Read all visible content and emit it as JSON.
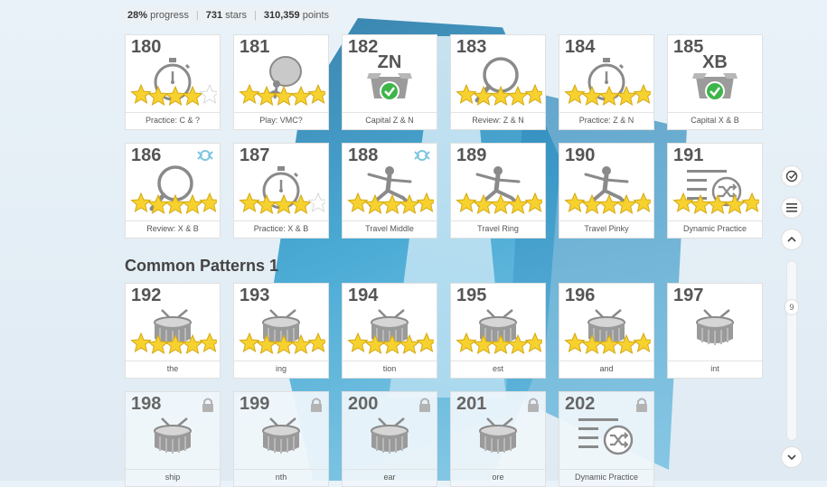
{
  "stats": {
    "progress_value": "28%",
    "progress_label": "progress",
    "stars_value": "731",
    "stars_label": "stars",
    "points_value": "310,359",
    "points_label": "points"
  },
  "section_title": "Common Patterns 1",
  "scroll_indicator": "9",
  "colors": {
    "star_fill": "#f7d22f",
    "star_stroke": "#d4a915",
    "star_empty": "#ffffff",
    "check_green": "#3eb54a",
    "icon_gray": "#8a8a8a"
  },
  "tiles": [
    {
      "num": "180",
      "label": "Practice: C & ?",
      "icon": "stopwatch-icon",
      "stars": 4
    },
    {
      "num": "181",
      "label": "Play: VMC?",
      "icon": "ball-player-icon",
      "stars": 5
    },
    {
      "num": "182",
      "label": "Capital Z & N",
      "icon": "box-check-icon",
      "letters": "ZN",
      "stars": 0
    },
    {
      "num": "183",
      "label": "Review: Z & N",
      "icon": "magnifier-icon",
      "stars": 5
    },
    {
      "num": "184",
      "label": "Practice: Z & N",
      "icon": "stopwatch-icon",
      "stars": 5
    },
    {
      "num": "185",
      "label": "Capital X & B",
      "icon": "box-check-icon",
      "letters": "XB",
      "stars": 0
    },
    {
      "num": "186",
      "label": "Review: X & B",
      "icon": "magnifier-icon",
      "stars": 5,
      "badge": "medal-icon"
    },
    {
      "num": "187",
      "label": "Practice: X & B",
      "icon": "stopwatch-icon",
      "stars": 4
    },
    {
      "num": "188",
      "label": "Travel Middle",
      "icon": "yoga-pose-icon",
      "stars": 5,
      "badge": "medal-icon"
    },
    {
      "num": "189",
      "label": "Travel Ring",
      "icon": "yoga-pose-icon",
      "stars": 5
    },
    {
      "num": "190",
      "label": "Travel Pinky",
      "icon": "yoga-pose-icon",
      "stars": 5
    },
    {
      "num": "191",
      "label": "Dynamic Practice",
      "icon": "shuffle-list-icon",
      "stars": 5
    },
    {
      "num": "192",
      "label": "the",
      "icon": "drum-icon",
      "stars": 5
    },
    {
      "num": "193",
      "label": "ing",
      "icon": "drum-icon",
      "stars": 5
    },
    {
      "num": "194",
      "label": "tion",
      "icon": "drum-icon",
      "stars": 5
    },
    {
      "num": "195",
      "label": "est",
      "icon": "drum-icon",
      "stars": 5
    },
    {
      "num": "196",
      "label": "and",
      "icon": "drum-icon",
      "stars": 5
    },
    {
      "num": "197",
      "label": "int",
      "icon": "drum-icon",
      "stars": 0
    },
    {
      "num": "198",
      "label": "ship",
      "icon": "drum-icon",
      "stars": 0,
      "locked": true
    },
    {
      "num": "199",
      "label": "nth",
      "icon": "drum-icon",
      "stars": 0,
      "locked": true
    },
    {
      "num": "200",
      "label": "ear",
      "icon": "drum-icon",
      "stars": 0,
      "locked": true
    },
    {
      "num": "201",
      "label": "ore",
      "icon": "drum-icon",
      "stars": 0,
      "locked": true
    },
    {
      "num": "202",
      "label": "Dynamic Practice",
      "icon": "shuffle-list-icon",
      "stars": 0,
      "locked": true
    }
  ]
}
